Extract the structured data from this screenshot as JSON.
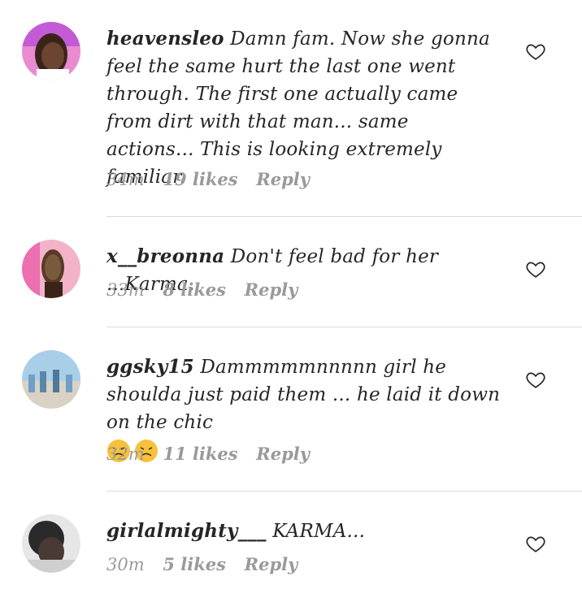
{
  "comments": [
    {
      "username": "heavensleo",
      "text": "Damn fam. Now she gonna feel the same hurt the last one went through. The first one actually came from dirt with that man... same actions... This is looking extremely familiar.",
      "time": "34m",
      "likes": "19 likes",
      "reply": "Reply",
      "avatar_icon": "avatar-heavensleo"
    },
    {
      "username": "x__breonna",
      "text": "Don't feel bad for her ...Karma.",
      "time": "33m",
      "likes": "8 likes",
      "reply": "Reply",
      "avatar_icon": "avatar-x-breonna"
    },
    {
      "username": "ggsky15",
      "text": "Dammmmmnnnnn girl he shoulda just paid them ... he laid it down on the chic",
      "emojis": [
        "persevering-face-emoji",
        "persevering-face-emoji"
      ],
      "time": "32m",
      "likes": "11 likes",
      "reply": "Reply",
      "avatar_icon": "avatar-ggsky15"
    },
    {
      "username": "girlalmighty___",
      "text": "KARMA...",
      "time": "30m",
      "likes": "5 likes",
      "reply": "Reply",
      "avatar_icon": "avatar-girlalmighty"
    }
  ],
  "colors": {
    "text": "#262626",
    "meta": "#9a9a9a",
    "divider": "#dbdbdb",
    "emoji": "#f7c23a"
  },
  "icons": {
    "like": "heart-outline-icon"
  }
}
